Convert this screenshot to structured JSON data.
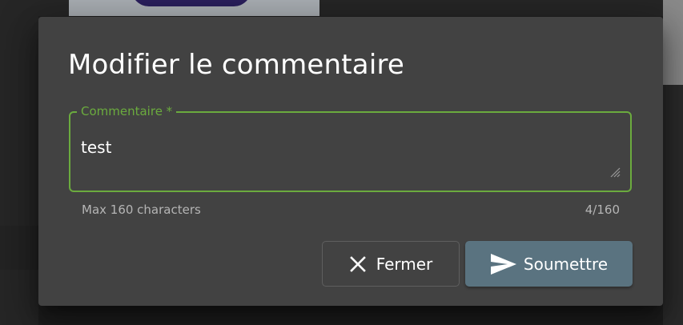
{
  "dialog": {
    "title": "Modifier le commentaire",
    "field": {
      "label": "Commentaire *",
      "value": "test",
      "hint": "Max 160 characters",
      "counter": "4/160"
    },
    "actions": {
      "close_label": "Fermer",
      "close_icon": "close-icon",
      "submit_label": "Soumettre",
      "submit_icon": "send-icon"
    }
  },
  "colors": {
    "accent_green": "#6bab3e",
    "dialog_bg": "#424242",
    "submit_bg": "#5a7380"
  }
}
